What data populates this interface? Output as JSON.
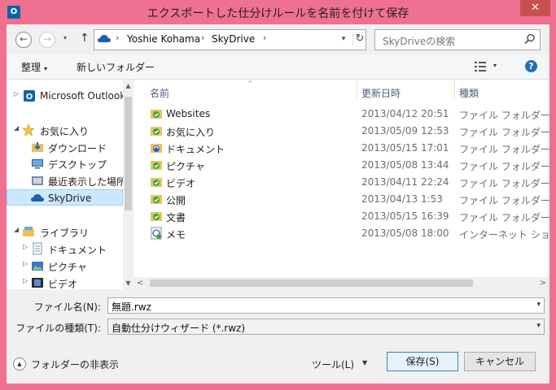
{
  "window": {
    "title": "エクスポートした仕分けルールを名前を付けて保存",
    "app_icon_text": "O",
    "close": "✕"
  },
  "nav": {
    "back": "←",
    "forward": "→",
    "up": "↑",
    "recent_caret": "▾"
  },
  "address": {
    "crumbs": [
      "Yoshie Kohama",
      "SkyDrive"
    ],
    "sep": "›",
    "dropdown": "▾",
    "refresh": "↻"
  },
  "search": {
    "placeholder": "SkyDriveの検索"
  },
  "toolbar": {
    "organize": "整理",
    "organize_caret": "▾",
    "new_folder": "新しいフォルダー",
    "view_caret": "▾",
    "help": "?"
  },
  "sidebar": {
    "items": [
      {
        "label": "Microsoft Outlook",
        "arrow": "▷",
        "icon": "outlook-icon"
      },
      {
        "label": "お気に入り",
        "arrow": "◢",
        "icon": "star-icon"
      },
      {
        "label": "ダウンロード",
        "icon": "download-folder-icon"
      },
      {
        "label": "デスクトップ",
        "icon": "desktop-icon"
      },
      {
        "label": "最近表示した場所",
        "icon": "recent-places-icon"
      },
      {
        "label": "SkyDrive",
        "icon": "skydrive-icon"
      },
      {
        "label": "ライブラリ",
        "arrow": "◢",
        "icon": "library-icon"
      },
      {
        "label": "ドキュメント",
        "arrow": "▷",
        "icon": "documents-icon"
      },
      {
        "label": "ピクチャ",
        "arrow": "▷",
        "icon": "pictures-icon"
      },
      {
        "label": "ビデオ",
        "arrow": "▷",
        "icon": "videos-icon"
      }
    ],
    "scroll_up": "▲",
    "scroll_down": "▼"
  },
  "columns": {
    "name": "名前",
    "date": "更新日時",
    "type": "種類",
    "sort_caret": "^"
  },
  "files": [
    {
      "name": "Websites",
      "date": "2013/04/12 20:51",
      "type": "ファイル フォルダー",
      "icon": "synced-folder-icon"
    },
    {
      "name": "お気に入り",
      "date": "2013/05/09 12:53",
      "type": "ファイル フォルダー",
      "icon": "synced-folder-icon"
    },
    {
      "name": "ドキュメント",
      "date": "2013/05/15 17:01",
      "type": "ファイル フォルダー",
      "icon": "syncing-folder-icon"
    },
    {
      "name": "ピクチャ",
      "date": "2013/05/08 13:44",
      "type": "ファイル フォルダー",
      "icon": "synced-folder-icon"
    },
    {
      "name": "ビデオ",
      "date": "2013/04/11 22:24",
      "type": "ファイル フォルダー",
      "icon": "synced-folder-icon"
    },
    {
      "name": "公開",
      "date": "2013/04/13 1:53",
      "type": "ファイル フォルダー",
      "icon": "synced-folder-icon"
    },
    {
      "name": "文書",
      "date": "2013/05/15 16:39",
      "type": "ファイル フォルダー",
      "icon": "synced-folder-icon"
    },
    {
      "name": "メモ",
      "date": "2013/05/08 18:00",
      "type": "インターネット ショー...",
      "icon": "internet-shortcut-icon"
    }
  ],
  "hscroll": {
    "left": "<",
    "right": ">"
  },
  "form": {
    "filename_label": "ファイル名(N):",
    "filename_value": "無題.rwz",
    "filetype_label": "ファイルの種類(T):",
    "filetype_value": "自動仕分けウィザード (*.rwz)",
    "caret": "▾"
  },
  "bottom": {
    "hide_folders": "フォルダーの非表示",
    "hide_folders_icon": "▲",
    "tools": "ツール(L)",
    "tools_caret": "▼",
    "save": "保存(S)",
    "cancel": "キャンセル"
  },
  "colors": {
    "frame": "#f0708f",
    "close": "#c7504f",
    "selected": "#cce8ff",
    "skydrive_blue": "#1d5fb0",
    "sync_green": "#3aa53a"
  }
}
